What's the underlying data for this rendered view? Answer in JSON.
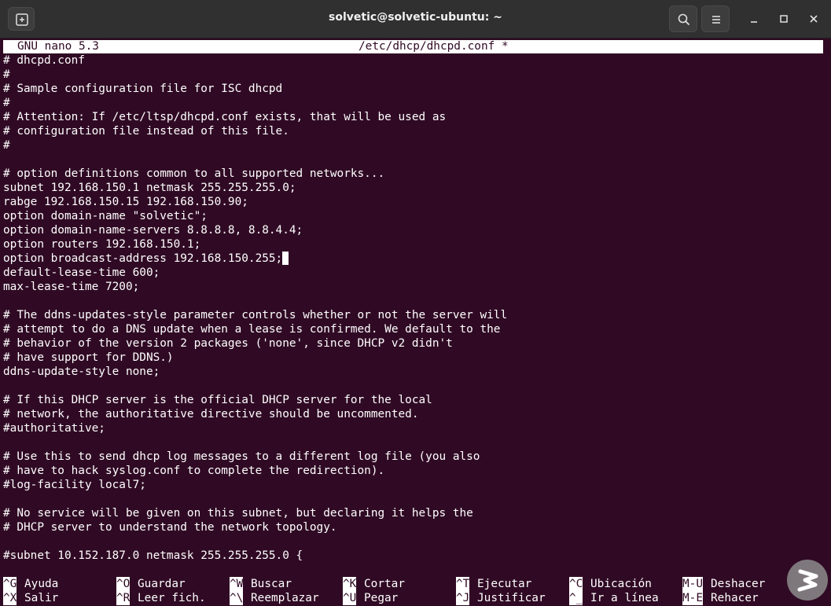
{
  "window": {
    "title": "solvetic@solvetic-ubuntu: ~"
  },
  "nano_header": {
    "version": "GNU nano 5.3",
    "filename": "/etc/dhcp/dhcpd.conf *"
  },
  "lines": [
    "# dhcpd.conf",
    "#",
    "# Sample configuration file for ISC dhcpd",
    "#",
    "# Attention: If /etc/ltsp/dhcpd.conf exists, that will be used as",
    "# configuration file instead of this file.",
    "#",
    "",
    "# option definitions common to all supported networks...",
    "subnet 192.168.150.1 netmask 255.255.255.0;",
    "rabge 192.168.150.15 192.168.150.90;",
    "option domain-name \"solvetic\";",
    "option domain-name-servers 8.8.8.8, 8.8.4.4;",
    "option routers 192.168.150.1;",
    "option broadcast-address 192.168.150.255;",
    "default-lease-time 600;",
    "max-lease-time 7200;",
    "",
    "# The ddns-updates-style parameter controls whether or not the server will",
    "# attempt to do a DNS update when a lease is confirmed. We default to the",
    "# behavior of the version 2 packages ('none', since DHCP v2 didn't",
    "# have support for DDNS.)",
    "ddns-update-style none;",
    "",
    "# If this DHCP server is the official DHCP server for the local",
    "# network, the authoritative directive should be uncommented.",
    "#authoritative;",
    "",
    "# Use this to send dhcp log messages to a different log file (you also",
    "# have to hack syslog.conf to complete the redirection).",
    "#log-facility local7;",
    "",
    "# No service will be given on this subnet, but declaring it helps the",
    "# DHCP server to understand the network topology.",
    "",
    "#subnet 10.152.187.0 netmask 255.255.255.0 {"
  ],
  "cursor_line": 14,
  "shortcuts": [
    {
      "key1": "^G",
      "label1": "Ayuda",
      "key2": "^X",
      "label2": "Salir"
    },
    {
      "key1": "^O",
      "label1": "Guardar",
      "key2": "^R",
      "label2": "Leer fich."
    },
    {
      "key1": "^W",
      "label1": "Buscar",
      "key2": "^\\",
      "label2": "Reemplazar"
    },
    {
      "key1": "^K",
      "label1": "Cortar",
      "key2": "^U",
      "label2": "Pegar"
    },
    {
      "key1": "^T",
      "label1": "Ejecutar",
      "key2": "^J",
      "label2": "Justificar"
    },
    {
      "key1": "^C",
      "label1": "Ubicación",
      "key2": "^_",
      "label2": "Ir a línea"
    },
    {
      "key1": "M-U",
      "label1": "Deshacer",
      "key2": "M-E",
      "label2": "Rehacer"
    }
  ],
  "colors": {
    "terminal_bg": "#300a24",
    "titlebar_bg": "#303030",
    "logo_color": "#8c8c8c"
  }
}
